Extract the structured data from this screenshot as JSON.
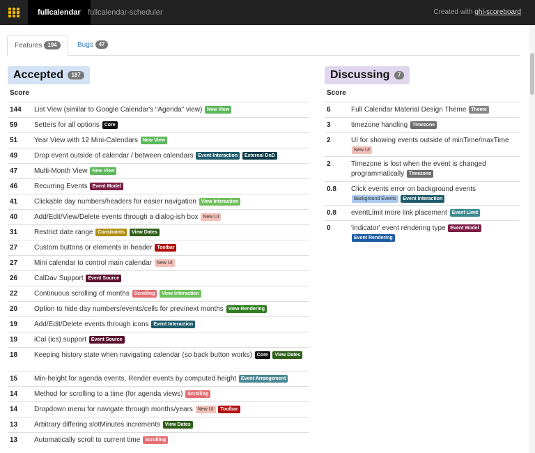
{
  "colors": {
    "new_view": "#5cb85c",
    "core": "#111111",
    "event_interaction": "#1f5c6b",
    "external_dnd": "#0d3b4a",
    "event_model": "#7b1c44",
    "view_interaction": "#6fbf5b",
    "new_ui": "#f2c0b8",
    "constraints": "#b08d10",
    "view_dates": "#2f5f1a",
    "toolbar": "#b0100e",
    "event_source": "#5c1030",
    "scrolling": "#e46d72",
    "view_rendering": "#2e7d1e",
    "event_arrangement": "#4e8a96",
    "theme": "#888888",
    "timezone": "#6d6d6d",
    "background_events": "#a9c8ee",
    "event_limit": "#3e8a93",
    "event_rendering": "#1c5aa3"
  },
  "topbar": {
    "brand": "fullcalendar",
    "brand2": "fullcalendar-scheduler",
    "created_prefix": "Created with ",
    "created_link": "ghi-scoreboard",
    "logo_icon": "calendar-grid-icon"
  },
  "tabs": [
    {
      "label": "Features",
      "count": "194"
    },
    {
      "label": "Bugs",
      "count": "47"
    }
  ],
  "accepted": {
    "title": "Accepted",
    "count": "187",
    "score_header": "Score",
    "rows": [
      {
        "score": "144",
        "title": "List View (similar to Google Calendar's “Agenda” view)",
        "labels": [
          [
            "New View",
            "new_view"
          ]
        ]
      },
      {
        "score": "59",
        "title": "Setters for all options",
        "labels": [
          [
            "Core",
            "core"
          ]
        ]
      },
      {
        "score": "51",
        "title": "Year View with 12 Mini-Calendars",
        "labels": [
          [
            "New View",
            "new_view"
          ]
        ]
      },
      {
        "score": "49",
        "title": "Drop event outside of calendar / between calendars",
        "labels": [
          [
            "Event Interaction",
            "event_interaction"
          ],
          [
            "External DnD",
            "external_dnd"
          ]
        ]
      },
      {
        "score": "47",
        "title": "Multi-Month View",
        "labels": [
          [
            "New View",
            "new_view"
          ]
        ]
      },
      {
        "score": "46",
        "title": "Recurring Events",
        "labels": [
          [
            "Event Model",
            "event_model"
          ]
        ]
      },
      {
        "score": "41",
        "title": "Clickable day numbers/headers for easier navigation",
        "labels": [
          [
            "View Interaction",
            "view_interaction"
          ]
        ]
      },
      {
        "score": "40",
        "title": "Add/Edit/View/Delete events through a dialog-ish box",
        "labels": [
          [
            "New UI",
            "new_ui"
          ]
        ]
      },
      {
        "score": "31",
        "title": "Restrict date range",
        "labels": [
          [
            "Constraints",
            "constraints"
          ],
          [
            "View Dates",
            "view_dates"
          ]
        ]
      },
      {
        "score": "27",
        "title": "Custom buttons or elements in header",
        "labels": [
          [
            "Toolbar",
            "toolbar"
          ]
        ]
      },
      {
        "score": "27",
        "title": "Mini calendar to control main calendar",
        "labels": [
          [
            "New UI",
            "new_ui"
          ]
        ]
      },
      {
        "score": "26",
        "title": "CalDav Support",
        "labels": [
          [
            "Event Source",
            "event_source"
          ]
        ]
      },
      {
        "score": "22",
        "title": "Continuous scrolling of months",
        "labels": [
          [
            "Scrolling",
            "scrolling"
          ],
          [
            "View Interaction",
            "view_interaction"
          ]
        ]
      },
      {
        "score": "20",
        "title": "Option to hide day numbers/events/cells for prev/next months",
        "labels": [
          [
            "View Rendering",
            "view_rendering"
          ]
        ]
      },
      {
        "score": "19",
        "title": "Add/Edit/Delete events through icons",
        "labels": [
          [
            "Event Interaction",
            "event_interaction"
          ]
        ]
      },
      {
        "score": "19",
        "title": "iCal (ics) support",
        "labels": [
          [
            "Event Source",
            "event_source"
          ]
        ]
      },
      {
        "score": "18",
        "title": "Keeping history state when navigating calendar (so back button works)",
        "labels": [
          [
            "Core",
            "core"
          ],
          [
            "View Dates",
            "view_dates"
          ]
        ]
      },
      {
        "score": "15",
        "title": "Min-height for agenda events. Render events by computed height",
        "labels": [
          [
            "Event Arrangement",
            "event_arrangement"
          ]
        ]
      },
      {
        "score": "14",
        "title": "Method for scrolling to a time (for agenda views)",
        "labels": [
          [
            "Scrolling",
            "scrolling"
          ]
        ]
      },
      {
        "score": "14",
        "title": "Dropdown menu for navigate through months/years",
        "labels": [
          [
            "New UI",
            "new_ui"
          ],
          [
            "Toolbar",
            "toolbar"
          ]
        ]
      },
      {
        "score": "13",
        "title": "Arbitrary differing slotMinutes increments",
        "labels": [
          [
            "View Dates",
            "view_dates"
          ]
        ]
      },
      {
        "score": "13",
        "title": "Automatically scroll to current time",
        "labels": [
          [
            "Scrolling",
            "scrolling"
          ]
        ]
      }
    ]
  },
  "discussing": {
    "title": "Discussing",
    "count": "7",
    "score_header": "Score",
    "rows": [
      {
        "score": "6",
        "title": "Full Calendar Material Design Theme",
        "labels": [
          [
            "Theme",
            "theme"
          ]
        ]
      },
      {
        "score": "3",
        "title": "timezone handling",
        "labels": [
          [
            "Timezone",
            "timezone"
          ]
        ]
      },
      {
        "score": "2",
        "title": "UI for showing events outside of minTime/maxTime",
        "labels": [
          [
            "New UI",
            "new_ui"
          ]
        ]
      },
      {
        "score": "2",
        "title": "Timezone is lost when the event is changed programmatically",
        "labels": [
          [
            "Timezone",
            "timezone"
          ]
        ]
      },
      {
        "score": "0.8",
        "title": "Click events error on background events",
        "labels": [
          [
            "Background Events",
            "background_events"
          ],
          [
            "Event Interaction",
            "event_interaction"
          ]
        ]
      },
      {
        "score": "0.8",
        "title": "eventLimit more link placement",
        "labels": [
          [
            "Event Limit",
            "event_limit"
          ]
        ]
      },
      {
        "score": "0",
        "title": "'indicator' event rendering type",
        "labels": [
          [
            "Event Model",
            "event_model"
          ],
          [
            "Event Rendering",
            "event_rendering"
          ]
        ]
      }
    ]
  }
}
